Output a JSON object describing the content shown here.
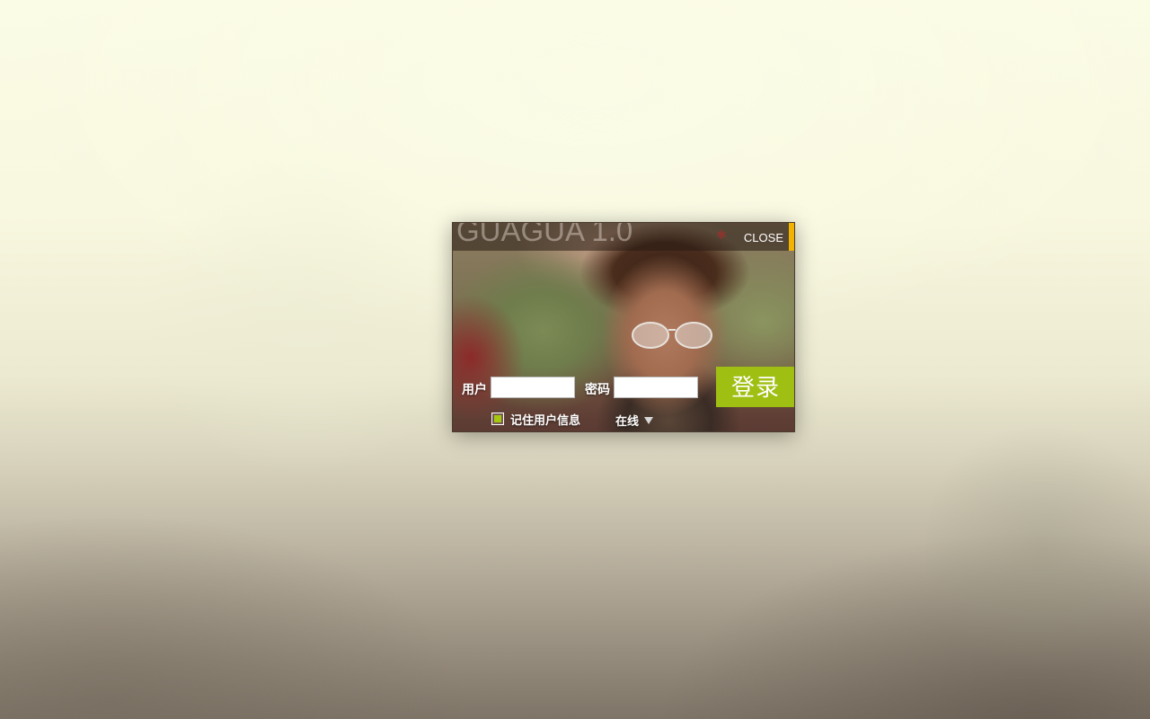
{
  "window": {
    "app_title": "GUAGUA 1.0",
    "close_label": "CLOSE"
  },
  "form": {
    "username_label": "用户",
    "username_value": "",
    "password_label": "密码",
    "password_value": "",
    "login_label": "登录",
    "remember_label": "记住用户信息",
    "remember_checked": true,
    "status_value": "在线"
  },
  "colors": {
    "accent_green": "#9fbf12",
    "accent_yellow": "#f2b400"
  }
}
